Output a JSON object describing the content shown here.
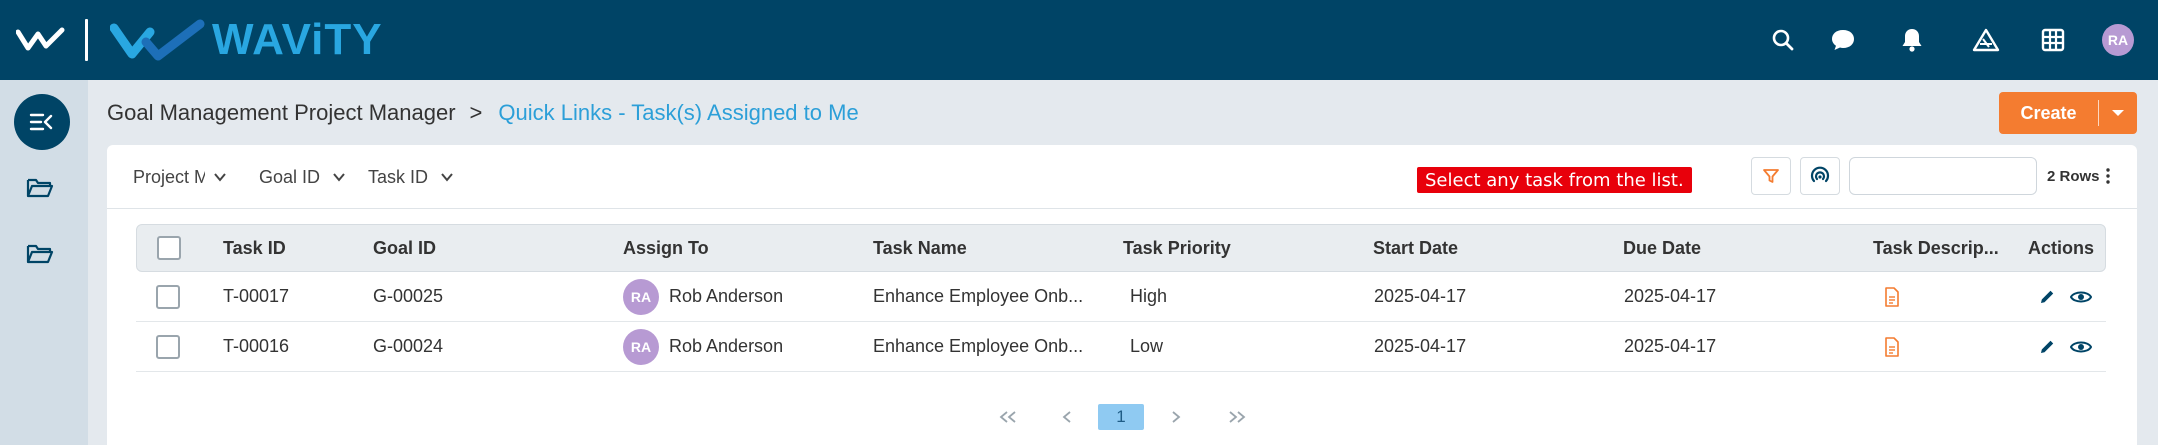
{
  "brand": {
    "name": "WAViTY"
  },
  "topbar": {
    "icons": [
      "search-icon",
      "chat-icon",
      "bell-icon",
      "alert-triangle-icon",
      "grid-icon"
    ],
    "user_initials": "RA"
  },
  "breadcrumb": {
    "root": "Goal Management Project Manager",
    "separator": ">",
    "current": "Quick Links - Task(s) Assigned to Me"
  },
  "create": {
    "label": "Create"
  },
  "filters": [
    {
      "label": "Project Manager"
    },
    {
      "label": "Goal ID"
    },
    {
      "label": "Task ID"
    }
  ],
  "hint": "Select any task from the list.",
  "search": {
    "placeholder": "",
    "value": ""
  },
  "rows_label": "2 Rows",
  "table": {
    "columns": [
      "Task ID",
      "Goal ID",
      "Assign To",
      "Task Name",
      "Task Priority",
      "Start Date",
      "Due Date",
      "Task Descrip...",
      "Actions"
    ],
    "rows": [
      {
        "task_id": "T-00017",
        "goal_id": "G-00025",
        "assignee_initials": "RA",
        "assignee": "Rob Anderson",
        "task_name": "Enhance Employee Onb...",
        "priority": "High",
        "start": "2025-04-17",
        "due": "2025-04-17"
      },
      {
        "task_id": "T-00016",
        "goal_id": "G-00024",
        "assignee_initials": "RA",
        "assignee": "Rob Anderson",
        "task_name": "Enhance Employee Onb...",
        "priority": "Low",
        "start": "2025-04-17",
        "due": "2025-04-17"
      }
    ]
  },
  "pagination": {
    "current": "1"
  },
  "colors": {
    "topbar": "#004466",
    "accent": "#f47c30",
    "link": "#2c9fd8",
    "brand": "#29a7e1",
    "hint_bg": "#e8000b"
  }
}
